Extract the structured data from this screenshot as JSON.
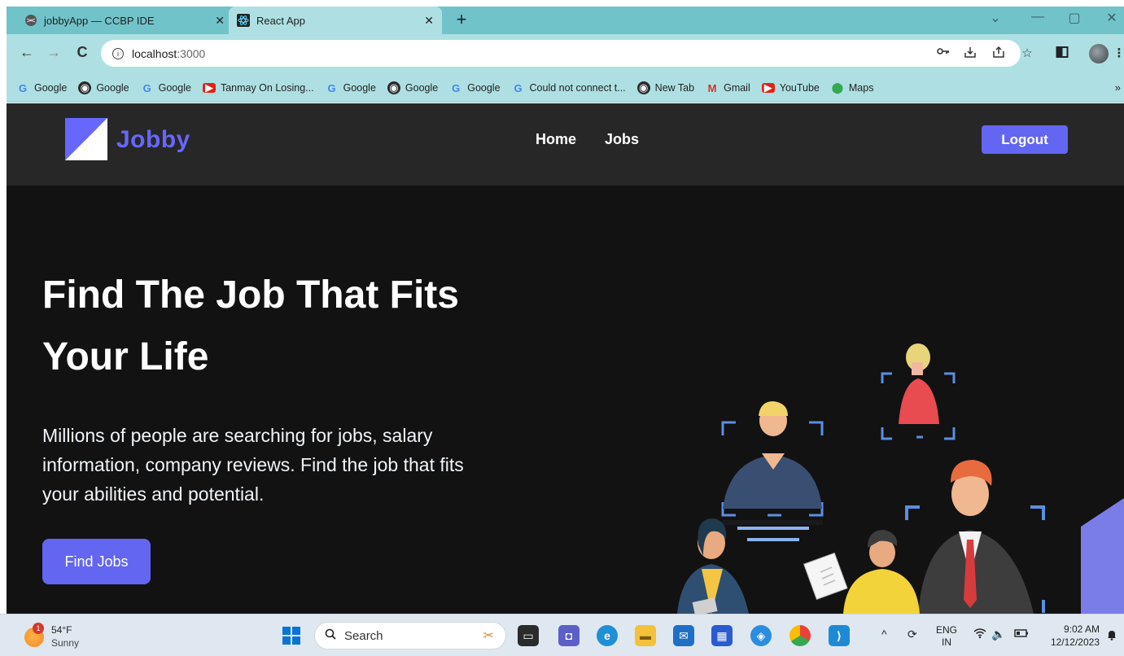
{
  "browser": {
    "tabs": [
      {
        "title": "jobbyApp — CCBP IDE",
        "active": false
      },
      {
        "title": "React App",
        "active": true
      }
    ],
    "new_tab_label": "+",
    "window_controls": {
      "minimize": "—",
      "maximize": "▢",
      "close": "✕",
      "tab_search": "⌄"
    },
    "url": {
      "host": "localhost",
      "port": ":3000"
    },
    "bookmarks": [
      {
        "label": "Google",
        "icon": "google-icon"
      },
      {
        "label": "Google",
        "icon": "globe-icon"
      },
      {
        "label": "Google",
        "icon": "google-icon"
      },
      {
        "label": "Tanmay On Losing...",
        "icon": "youtube-icon"
      },
      {
        "label": "Google",
        "icon": "google-icon"
      },
      {
        "label": "Google",
        "icon": "globe-icon"
      },
      {
        "label": "Google",
        "icon": "google-icon"
      },
      {
        "label": "Could not connect t...",
        "icon": "google-icon"
      },
      {
        "label": "New Tab",
        "icon": "globe-icon"
      },
      {
        "label": "Gmail",
        "icon": "gmail-icon"
      },
      {
        "label": "YouTube",
        "icon": "youtube-icon"
      },
      {
        "label": "Maps",
        "icon": "maps-icon"
      }
    ],
    "bookmarks_more": "»"
  },
  "app": {
    "brand": {
      "name": "Jobby",
      "accent": "#6767ff"
    },
    "nav": {
      "home": "Home",
      "jobs": "Jobs"
    },
    "logout_label": "Logout",
    "hero": {
      "heading": "Find The Job That Fits Your Life",
      "description": "Millions of people are searching for jobs, salary information, company reviews. Find the job that fits your abilities and potential.",
      "cta_label": "Find Jobs"
    },
    "colors": {
      "button": "#6366f1",
      "header_bg": "#272727",
      "page_bg": "#121212"
    }
  },
  "taskbar": {
    "weather": {
      "temp": "54°F",
      "condition": "Sunny",
      "badge": "1"
    },
    "search_placeholder": "Search",
    "language": {
      "line1": "ENG",
      "line2": "IN"
    },
    "clock": {
      "time": "9:02 AM",
      "date": "12/12/2023"
    }
  }
}
